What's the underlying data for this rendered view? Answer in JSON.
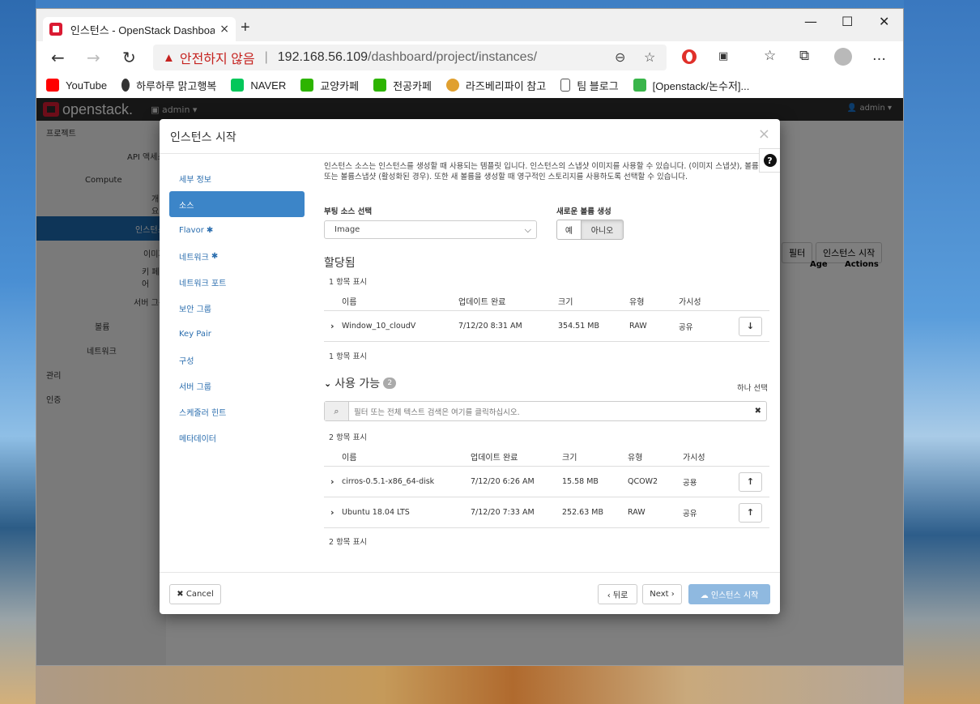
{
  "browser": {
    "tab_title": "인스턴스 - OpenStack Dashboard",
    "tab_close": "×",
    "new_tab": "+",
    "minimize": "—",
    "maximize": "☐",
    "close": "✕",
    "security_warning": "안전하지 않음",
    "url_host": "192.168.56.109",
    "url_path": "/dashboard/project/instances/",
    "bookmarks": [
      {
        "label": "YouTube",
        "color": "#ff0000"
      },
      {
        "label": "하루하루 맑고행복",
        "color": "#333333"
      },
      {
        "label": "NAVER",
        "color": "#03c75a"
      },
      {
        "label": "교양카페",
        "color": "#2db400"
      },
      {
        "label": "전공카페",
        "color": "#2db400"
      },
      {
        "label": "라즈베리파이 참고",
        "color": "#e0a030"
      },
      {
        "label": "팀 블로그",
        "color": "#555555"
      },
      {
        "label": "[Openstack/논수저]...",
        "color": "#39b54a"
      }
    ]
  },
  "openstack": {
    "logo": "openstack.",
    "project_menu": "▣ admin ▾",
    "user_menu": "👤 admin ▾",
    "sidebar": [
      "프로젝트",
      "API 액세스",
      "Compute",
      "개요",
      "인스턴스",
      "이미지",
      "키 페어",
      "서버 그룹",
      "볼륨",
      "네트워크",
      "관리",
      "인증"
    ],
    "filter_btn": "필터",
    "launch_btn": "인스턴스 시작",
    "col_age": "Age",
    "col_actions": "Actions"
  },
  "modal": {
    "title": "인스턴스 시작",
    "close": "×",
    "help": "?",
    "steps": [
      {
        "label": "세부 정보",
        "required": false
      },
      {
        "label": "소스",
        "required": false
      },
      {
        "label": "Flavor",
        "required": true
      },
      {
        "label": "네트워크",
        "required": true
      },
      {
        "label": "네트워크 포트",
        "required": false
      },
      {
        "label": "보안 그룹",
        "required": false
      },
      {
        "label": "Key Pair",
        "required": false
      },
      {
        "label": "구성",
        "required": false
      },
      {
        "label": "서버 그룹",
        "required": false
      },
      {
        "label": "스케줄러 힌트",
        "required": false
      },
      {
        "label": "메타데이터",
        "required": false
      }
    ],
    "active_step": "소스",
    "description": "인스턴스 소스는 인스턴스를 생성할 때 사용되는 템플릿 입니다. 인스턴스의 스냅샷 이미지를 사용할 수 있습니다. (이미지 스냅샷), 볼륨 또는 볼륨스냅샷 (활성화된 경우). 또한 새 볼륨을 생성할 때 영구적인 스토리지를 사용하도록 선택할 수 있습니다.",
    "boot_source_label": "부팅 소스 선택",
    "boot_source_value": "Image",
    "new_volume_label": "새로운 볼륨 생성",
    "new_volume_yes": "예",
    "new_volume_no": "아니오",
    "allocated": {
      "title": "할당됨",
      "count_text": "1 항목 표시",
      "headers": [
        "이름",
        "업데이트 완료",
        "크기",
        "유형",
        "가시성"
      ],
      "rows": [
        {
          "name": "Window_10_cloudV",
          "updated": "7/12/20 8:31 AM",
          "size": "354.51 MB",
          "type": "RAW",
          "visibility": "공유"
        }
      ]
    },
    "available": {
      "title": "사용 가능",
      "count_badge": "2",
      "select_one": "하나 선택",
      "filter_placeholder": "필터 또는 전체 텍스트 검색은 여기를 클릭하십시오.",
      "count_text": "2 항목 표시",
      "headers": [
        "이름",
        "업데이트 완료",
        "크기",
        "유형",
        "가시성"
      ],
      "rows": [
        {
          "name": "cirros-0.5.1-x86_64-disk",
          "updated": "7/12/20 6:26 AM",
          "size": "15.58 MB",
          "type": "QCOW2",
          "visibility": "공용"
        },
        {
          "name": "Ubuntu 18.04 LTS",
          "updated": "7/12/20 7:33 AM",
          "size": "252.63 MB",
          "type": "RAW",
          "visibility": "공유"
        }
      ]
    },
    "footer": {
      "cancel": "✖ Cancel",
      "back": "‹ 뒤로",
      "next": "Next ›",
      "launch": "☁ 인스턴스 시작"
    }
  }
}
